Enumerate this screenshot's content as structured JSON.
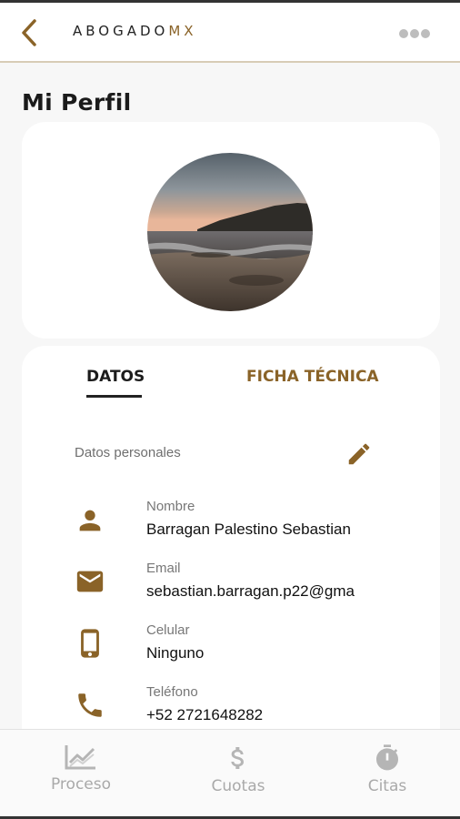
{
  "header": {
    "brand_main": "ABOGADO",
    "brand_accent": "MX",
    "back_icon": "chevron-left-icon",
    "more_icon": "more-horizontal-icon"
  },
  "page": {
    "title": "Mi Perfil"
  },
  "profile": {
    "avatar": "beach-sunset-photo"
  },
  "tabs": [
    {
      "label": "DATOS",
      "active": true
    },
    {
      "label": "FICHA TÉCNICA",
      "active": false
    }
  ],
  "section": {
    "label": "Datos personales",
    "edit_icon": "pencil-icon"
  },
  "fields": [
    {
      "label": "Nombre",
      "value": "Barragan Palestino Sebastian",
      "icon": "person-icon"
    },
    {
      "label": "Email",
      "value": "sebastian.barragan.p22@gma",
      "icon": "mail-icon"
    },
    {
      "label": "Celular",
      "value": "Ninguno",
      "icon": "smartphone-icon"
    },
    {
      "label": "Teléfono",
      "value": "+52 2721648282",
      "icon": "phone-icon"
    }
  ],
  "nav": [
    {
      "label": "Proceso",
      "icon": "chart-icon"
    },
    {
      "label": "Cuotas",
      "icon": "dollar-icon"
    },
    {
      "label": "Citas",
      "icon": "stopwatch-icon"
    }
  ],
  "colors": {
    "accent": "#8a6328",
    "text": "#1b1b1b",
    "muted": "#a9a9a9"
  }
}
